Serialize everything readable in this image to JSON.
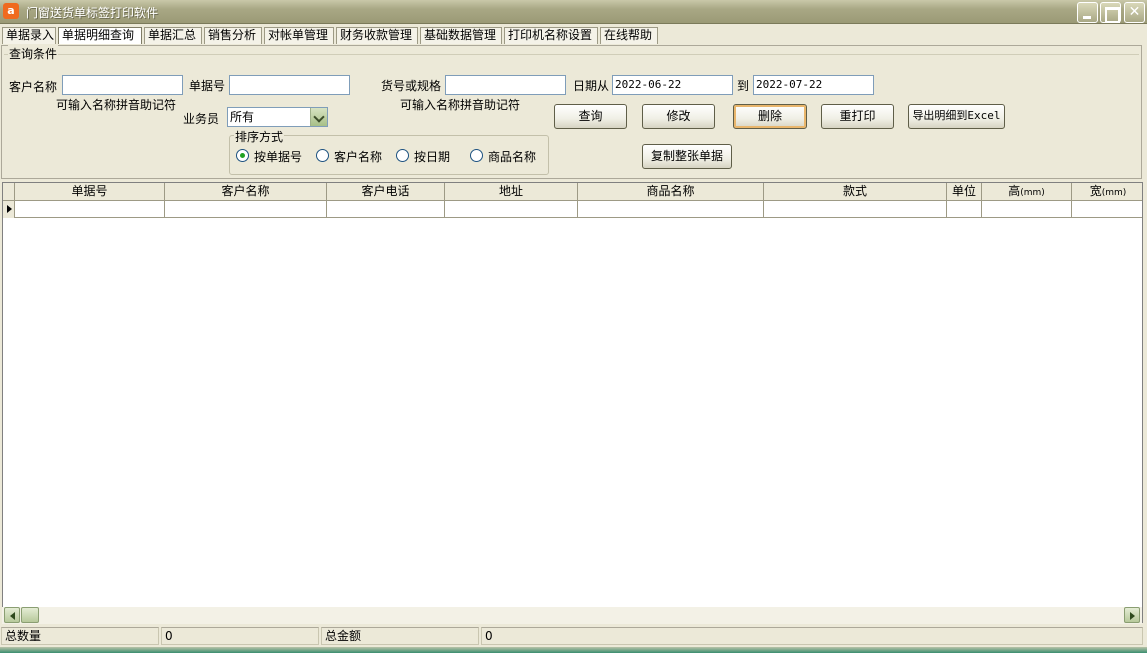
{
  "window": {
    "title": "门窗送货单标签打印软件",
    "icon_letter": "a"
  },
  "menu": [
    {
      "label": "单据录入"
    },
    {
      "label": "单据明细查询"
    },
    {
      "label": "单据汇总"
    },
    {
      "label": "销售分析"
    },
    {
      "label": "对帐单管理"
    },
    {
      "label": "财务收款管理"
    },
    {
      "label": "基础数据管理"
    },
    {
      "label": "打印机名称设置"
    },
    {
      "label": "在线帮助"
    }
  ],
  "query": {
    "legend": "查询条件",
    "customer_label": "客户名称",
    "customer_value": "",
    "customer_hint": "可输入名称拼音助记符",
    "order_no_label": "单据号",
    "order_no_value": "",
    "product_label": "货号或规格",
    "product_value": "",
    "product_hint": "可输入名称拼音助记符",
    "date_from_label": "日期从",
    "date_from": "2022-06-22",
    "date_to_label": "到",
    "date_to": "2022-07-22",
    "salesman_label": "业务员",
    "salesman_value": "所有",
    "sort_legend": "排序方式",
    "sort_options": [
      {
        "label": "按单据号",
        "selected": true
      },
      {
        "label": "客户名称",
        "selected": false
      },
      {
        "label": "按日期",
        "selected": false
      },
      {
        "label": "商品名称",
        "selected": false
      }
    ]
  },
  "buttons": {
    "query": "查询",
    "edit": "修改",
    "delete": "删除",
    "reprint": "重打印",
    "export": "导出明细到Excel",
    "copy": "复制整张单据"
  },
  "grid": {
    "columns": [
      {
        "label": "单据号",
        "unit": ""
      },
      {
        "label": "客户名称",
        "unit": ""
      },
      {
        "label": "客户电话",
        "unit": ""
      },
      {
        "label": "地址",
        "unit": ""
      },
      {
        "label": "商品名称",
        "unit": ""
      },
      {
        "label": "款式",
        "unit": ""
      },
      {
        "label": "单位",
        "unit": ""
      },
      {
        "label": "高",
        "unit": "(mm)"
      },
      {
        "label": "宽",
        "unit": "(mm)"
      }
    ]
  },
  "status": {
    "total_qty_label": "总数量",
    "total_qty": "0",
    "total_amount_label": "总金额",
    "total_amount": "0"
  }
}
